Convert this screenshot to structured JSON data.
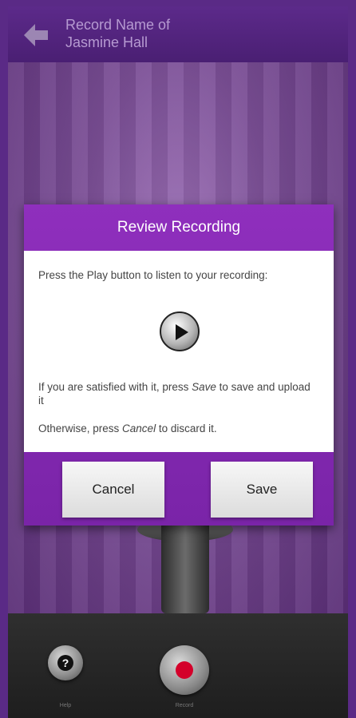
{
  "header": {
    "title": "Record Name of\nJasmine Hall"
  },
  "dialog": {
    "title": "Review Recording",
    "intro": "Press the Play button to listen to your recording:",
    "save_text_prefix": "If you are satisfied with it, press ",
    "save_text_em": "Save",
    "save_text_suffix": " to save and upload it",
    "cancel_text_prefix": "Otherwise, press ",
    "cancel_text_em": "Cancel",
    "cancel_text_suffix": " to discard it.",
    "buttons": {
      "cancel_label": "Cancel",
      "save_label": "Save"
    }
  },
  "bottom_bar": {
    "help_label": "Help",
    "record_label": "Record"
  },
  "icons": {
    "back": "back-arrow-icon",
    "play": "play-icon",
    "help": "question-icon",
    "record": "record-icon"
  },
  "colors": {
    "accent": "#8f2fbd",
    "header": "#4a1f73",
    "record": "#d4002a"
  }
}
